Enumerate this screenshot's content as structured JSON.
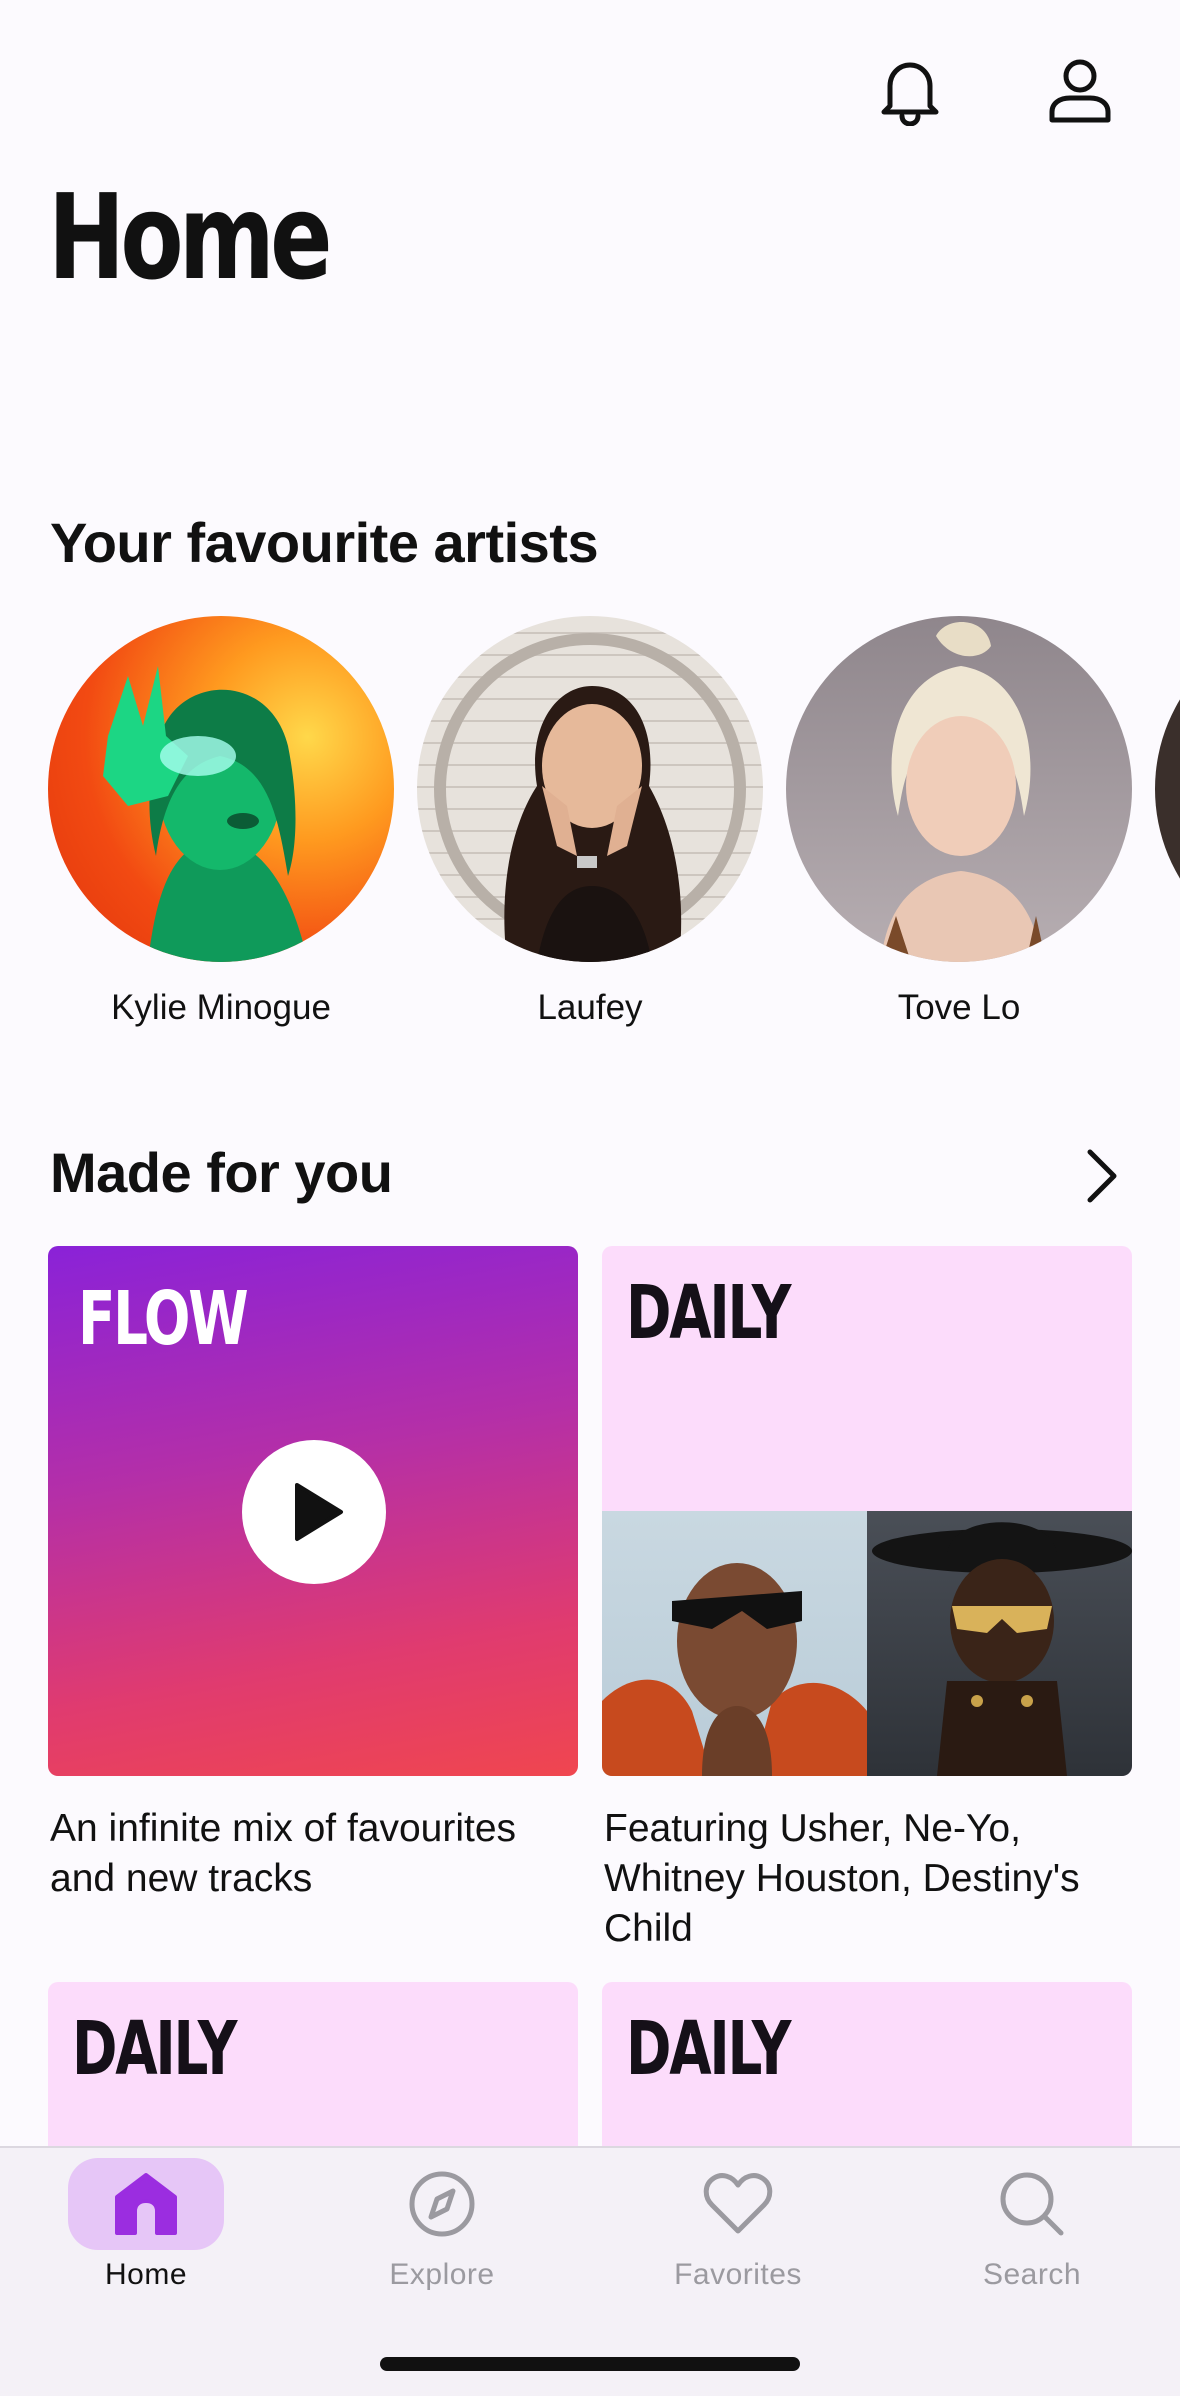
{
  "header": {
    "title": "Home",
    "icons": [
      "bell-icon",
      "profile-icon"
    ]
  },
  "favourite_artists": {
    "title": "Your favourite artists",
    "items": [
      {
        "name": "Kylie Minogue"
      },
      {
        "name": "Laufey"
      },
      {
        "name": "Tove Lo"
      }
    ]
  },
  "made_for_you": {
    "title": "Made for you",
    "cards": [
      {
        "label": "FLOW",
        "description": "An infinite mix of favourites and new tracks"
      },
      {
        "label": "DAILY",
        "description": "Featuring Usher, Ne-Yo, Whitney Houston, Destiny's Child"
      },
      {
        "label": "DAILY"
      },
      {
        "label": "DAILY"
      }
    ]
  },
  "tabbar": {
    "tabs": [
      {
        "label": "Home",
        "icon": "home-icon",
        "active": true
      },
      {
        "label": "Explore",
        "icon": "compass-icon"
      },
      {
        "label": "Favorites",
        "icon": "heart-icon"
      },
      {
        "label": "Search",
        "icon": "search-icon"
      }
    ]
  },
  "colors": {
    "accent": "#9b2de0",
    "accent_bg": "#e6c6f7",
    "daily_bg": "#fcdcfb",
    "flow_gradient_top": "#8a22d8",
    "flow_gradient_bottom": "#f0464f"
  }
}
